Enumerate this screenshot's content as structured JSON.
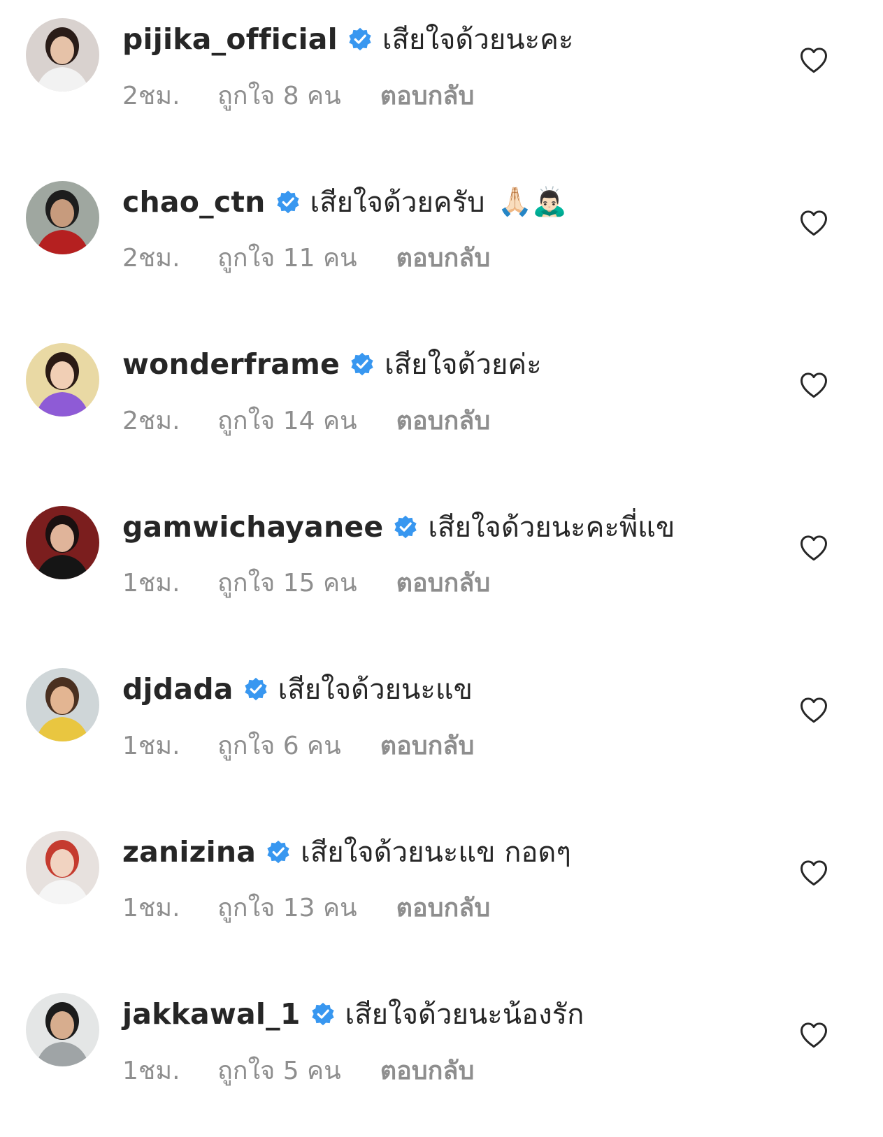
{
  "colors": {
    "text_primary": "#262626",
    "text_secondary": "#8e8e8e",
    "verified_blue": "#3897f0"
  },
  "comments": [
    {
      "username": "pijika_official",
      "text": "เสียใจด้วยนะคะ",
      "emoji": "",
      "time": "2ชม.",
      "likes": "ถูกใจ 8 คน",
      "reply": "ตอบกลับ"
    },
    {
      "username": "chao_ctn",
      "text": "เสียใจด้วยครับ",
      "emoji": "🙏🏻🙇🏻‍♂️",
      "time": "2ชม.",
      "likes": "ถูกใจ 11 คน",
      "reply": "ตอบกลับ"
    },
    {
      "username": "wonderframe",
      "text": "เสียใจด้วยค่ะ",
      "emoji": "",
      "time": "2ชม.",
      "likes": "ถูกใจ 14 คน",
      "reply": "ตอบกลับ"
    },
    {
      "username": "gamwichayanee",
      "text": "เสียใจด้วยนะคะพี่แข",
      "emoji": "",
      "time": "1ชม.",
      "likes": "ถูกใจ 15 คน",
      "reply": "ตอบกลับ"
    },
    {
      "username": "djdada",
      "text": "เสียใจด้วยนะแข",
      "emoji": "",
      "time": "1ชม.",
      "likes": "ถูกใจ 6 คน",
      "reply": "ตอบกลับ"
    },
    {
      "username": "zanizina",
      "text": "เสียใจด้วยนะแข กอดๆ",
      "emoji": "",
      "time": "1ชม.",
      "likes": "ถูกใจ 13 คน",
      "reply": "ตอบกลับ"
    },
    {
      "username": "jakkawal_1",
      "text": "เสียใจด้วยนะน้องรัก",
      "emoji": "",
      "time": "1ชม.",
      "likes": "ถูกใจ 5 คน",
      "reply": "ตอบกลับ"
    }
  ]
}
